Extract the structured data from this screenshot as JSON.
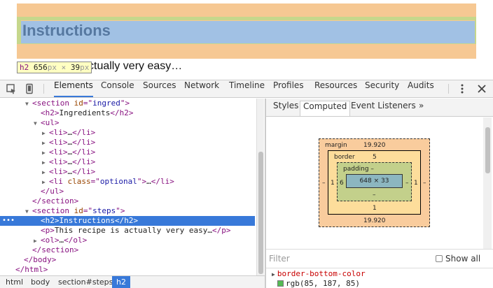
{
  "preview": {
    "heading": "Instructions",
    "paragraph_visible": "ctually very easy…",
    "tooltip": {
      "tag": "h2",
      "width": "656",
      "unit1": "px",
      "times": "×",
      "height": "39",
      "unit2": "px"
    }
  },
  "toolbar": {
    "tabs": [
      "Elements",
      "Console",
      "Sources",
      "Network",
      "Timeline",
      "Profiles",
      "Resources",
      "Security",
      "Audits"
    ],
    "active_tab": "Elements",
    "icons": [
      "inspect-icon",
      "device-mode-icon",
      "more-vert-icon",
      "close-icon"
    ]
  },
  "dom_tree": [
    {
      "indent": 2,
      "arrow": "▼",
      "parts": [
        [
          "tg",
          "<section "
        ],
        [
          "an",
          "id"
        ],
        [
          "tg",
          "=\""
        ],
        [
          "av",
          "ingred"
        ],
        [
          "tg",
          "\">"
        ]
      ]
    },
    {
      "indent": 3,
      "arrow": "",
      "parts": [
        [
          "tg",
          "<h2>"
        ],
        [
          "tx",
          "Ingredients"
        ],
        [
          "tg",
          "</h2>"
        ]
      ]
    },
    {
      "indent": 3,
      "arrow": "▼",
      "parts": [
        [
          "tg",
          "<ul>"
        ]
      ]
    },
    {
      "indent": 4,
      "arrow": "▶",
      "parts": [
        [
          "tg",
          "<li>"
        ],
        [
          "tx",
          "…"
        ],
        [
          "tg",
          "</li>"
        ]
      ]
    },
    {
      "indent": 4,
      "arrow": "▶",
      "parts": [
        [
          "tg",
          "<li>"
        ],
        [
          "tx",
          "…"
        ],
        [
          "tg",
          "</li>"
        ]
      ]
    },
    {
      "indent": 4,
      "arrow": "▶",
      "parts": [
        [
          "tg",
          "<li>"
        ],
        [
          "tx",
          "…"
        ],
        [
          "tg",
          "</li>"
        ]
      ]
    },
    {
      "indent": 4,
      "arrow": "▶",
      "parts": [
        [
          "tg",
          "<li>"
        ],
        [
          "tx",
          "…"
        ],
        [
          "tg",
          "</li>"
        ]
      ]
    },
    {
      "indent": 4,
      "arrow": "▶",
      "parts": [
        [
          "tg",
          "<li>"
        ],
        [
          "tx",
          "…"
        ],
        [
          "tg",
          "</li>"
        ]
      ]
    },
    {
      "indent": 4,
      "arrow": "▶",
      "parts": [
        [
          "tg",
          "<li "
        ],
        [
          "an",
          "class"
        ],
        [
          "tg",
          "=\""
        ],
        [
          "av",
          "optional"
        ],
        [
          "tg",
          "\">"
        ],
        [
          "tx",
          "…"
        ],
        [
          "tg",
          "</li>"
        ]
      ]
    },
    {
      "indent": 3,
      "arrow": "",
      "parts": [
        [
          "tg",
          "</ul>"
        ]
      ]
    },
    {
      "indent": 2,
      "arrow": "",
      "parts": [
        [
          "tg",
          "</section>"
        ]
      ]
    },
    {
      "indent": 2,
      "arrow": "▼",
      "parts": [
        [
          "tg",
          "<section "
        ],
        [
          "an",
          "id"
        ],
        [
          "tg",
          "=\""
        ],
        [
          "av",
          "steps"
        ],
        [
          "tg",
          "\">"
        ]
      ]
    },
    {
      "indent": 3,
      "arrow": "",
      "selected": true,
      "parts": [
        [
          "tg",
          "<h2>"
        ],
        [
          "tx",
          "Instructions"
        ],
        [
          "tg",
          "</h2>"
        ]
      ]
    },
    {
      "indent": 3,
      "arrow": "",
      "parts": [
        [
          "tg",
          "<p>"
        ],
        [
          "tx",
          "This recipe is actually very easy…"
        ],
        [
          "tg",
          "</p>"
        ]
      ]
    },
    {
      "indent": 3,
      "arrow": "▶",
      "parts": [
        [
          "tg",
          "<ol>"
        ],
        [
          "tx",
          "…"
        ],
        [
          "tg",
          "</ol>"
        ]
      ]
    },
    {
      "indent": 2,
      "arrow": "",
      "parts": [
        [
          "tg",
          "</section>"
        ]
      ]
    },
    {
      "indent": 1,
      "arrow": "",
      "parts": [
        [
          "tg",
          "</body>"
        ]
      ]
    },
    {
      "indent": 0,
      "arrow": "",
      "parts": [
        [
          "tg",
          "</html>"
        ]
      ]
    }
  ],
  "selected_dots": "•••",
  "breadcrumbs": [
    "html",
    "body",
    "section#steps",
    "h2"
  ],
  "side_tabs": [
    "Styles",
    "Computed",
    "Event Listeners",
    "»"
  ],
  "side_active_tab": "Computed",
  "box_model": {
    "margin_label": "margin",
    "margin_top": "19.920",
    "margin_bottom": "19.920",
    "margin_left": "–",
    "margin_right": "–",
    "border_label": "border",
    "border_top": "5",
    "border_bottom": "1",
    "border_left": "1",
    "border_right": "1",
    "padding_label": "padding –",
    "padding_left": "6",
    "padding_right": "–",
    "padding_bottom": "–",
    "content": "648 × 33"
  },
  "filter": {
    "placeholder": "Filter",
    "show_all_label": "Show all"
  },
  "computed_property": {
    "name": "border-bottom-color",
    "value": "rgb(85, 187, 85)",
    "swatch_color": "#55bb55"
  },
  "colors": {
    "accent": "#3879d9",
    "tag": "#881280",
    "attr_name": "#994500",
    "attr_value": "#1a1aa6"
  }
}
